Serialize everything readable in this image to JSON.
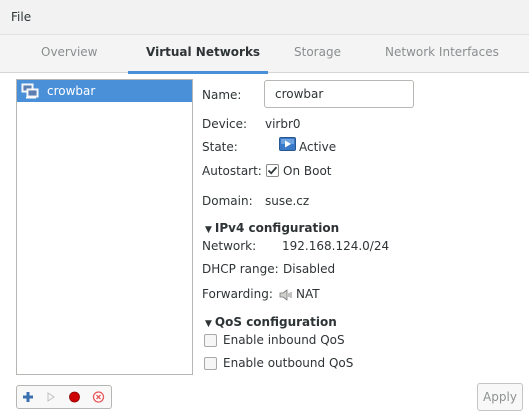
{
  "menubar": {
    "file": "File"
  },
  "tabs": [
    {
      "label": "Overview"
    },
    {
      "label": "Virtual Networks"
    },
    {
      "label": "Storage"
    },
    {
      "label": "Network Interfaces"
    }
  ],
  "networks": [
    {
      "label": "crowbar",
      "icon": "network-icon"
    }
  ],
  "details": {
    "name_label": "Name:",
    "name_value": "crowbar",
    "device_label": "Device:",
    "device_value": "virbr0",
    "state_label": "State:",
    "state_value": "Active",
    "autostart_label": "Autostart:",
    "autostart_value": "On Boot",
    "autostart_checked": true,
    "domain_label": "Domain:",
    "domain_value": "suse.cz"
  },
  "ipv4": {
    "title": "IPv4 configuration",
    "network_label": "Network:",
    "network_value": "192.168.124.0/24",
    "dhcp_label": "DHCP range:",
    "dhcp_value": "Disabled",
    "forwarding_label": "Forwarding:",
    "forwarding_value": "NAT"
  },
  "qos": {
    "title": "QoS configuration",
    "inbound_label": "Enable inbound QoS",
    "outbound_label": "Enable outbound QoS"
  },
  "buttons": {
    "apply": "Apply"
  },
  "colors": {
    "accent": "#4a90d9",
    "stop_red": "#cc0000",
    "delete_red": "#e8575a"
  }
}
